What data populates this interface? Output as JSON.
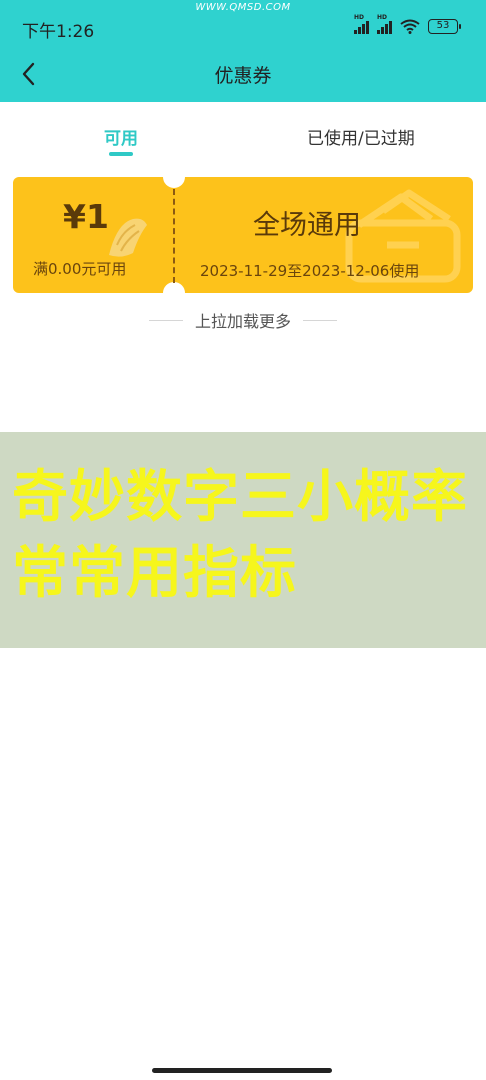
{
  "status_bar": {
    "time": "下午1:26",
    "watermark": "WWW.QMSD.COM",
    "network_label": "HD",
    "battery": "53"
  },
  "header": {
    "title": "优惠券",
    "back_icon": "chevron-left-icon",
    "background": "#2fd2cf"
  },
  "tabs": [
    {
      "label": "可用",
      "active": true
    },
    {
      "label": "已使用/已过期",
      "active": false
    }
  ],
  "coupons": [
    {
      "amount": "¥1",
      "condition": "满0.00元可用",
      "name": "全场通用",
      "dates": "2023-11-29至2023-12-06使用",
      "color": "#fdc21b"
    }
  ],
  "load_more": "上拉加载更多",
  "banner": {
    "text": "奇妙数字三小概率常常用指标",
    "background": "#ced9c3",
    "text_color": "#f6f61c"
  },
  "accent_color": "#2fc9c6"
}
